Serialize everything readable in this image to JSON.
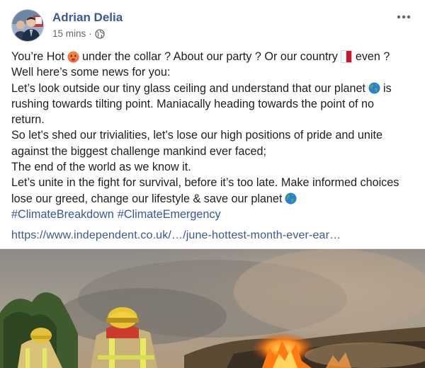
{
  "post": {
    "author": "Adrian Delia",
    "timestamp": "15 mins",
    "separator": "·",
    "privacy_icon": "globe-icon",
    "more_icon": "more-horizontal-icon",
    "body": {
      "line1_a": "You’re Hot",
      "line1_b": "under the collar ? About our party ? Or our country",
      "line1_c": "even ?",
      "line2": "Well here’s some news for you:",
      "line3_a": "Let’s look outside our tiny glass ceiling and understand that our planet",
      "line3_b": "is",
      "line4": "rushing towards tilting point. Maniacally heading towards the point of no",
      "line5": "return.",
      "line6": "So let’s shed our trivialities, let’s lose our high positions of pride and unite",
      "line7": "against the biggest challenge mankind ever faced;",
      "line8": "The end of the world as we know it.",
      "line9": "Let’s unite in the fight for survival, before it’s too late. Make informed choices",
      "line10": "lose our greed, change our lifestyle & save our planet",
      "hashtags": [
        "#ClimateBreakdown",
        "#ClimateEmergency"
      ]
    },
    "link": "https://www.independent.co.uk/…/june-hottest-month-ever-ear…",
    "emojis": {
      "hot_face": "hot-face-emoji",
      "malta_flag": "malta-flag-icon",
      "earth_globe": "earth-globe-emoji"
    },
    "colors": {
      "link_blue": "#385898",
      "text": "#1c1e21",
      "meta_gray": "#616770",
      "flag_red": "#cf142b"
    }
  }
}
